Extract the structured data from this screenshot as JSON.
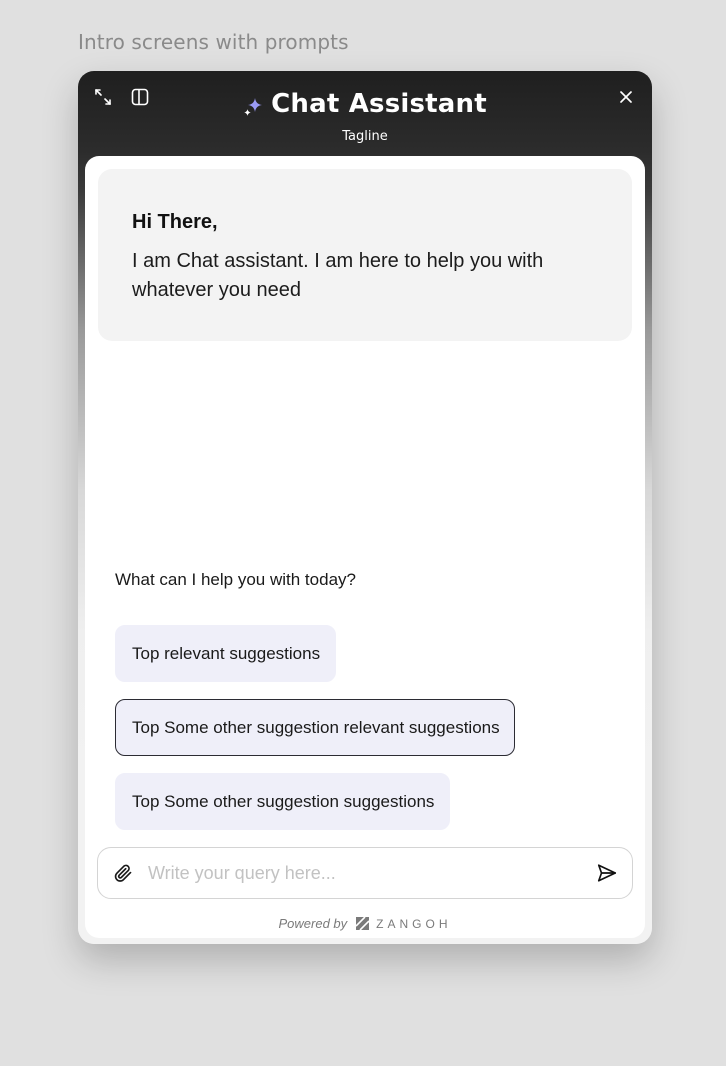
{
  "page": {
    "caption": "Intro screens with prompts"
  },
  "header": {
    "title": "Chat Assistant",
    "tagline": "Tagline",
    "icons": {
      "expand": "expand-icon",
      "split": "split-panel-icon",
      "close": "close-icon",
      "sparkle": "sparkle-icon"
    },
    "accent_color": "#8b8bf0"
  },
  "greeting": {
    "title": "Hi There,",
    "body": "I am Chat assistant. I am here to help you with whatever you need"
  },
  "prompts": {
    "heading": "What can I help you with today?",
    "suggestions": [
      {
        "label": "Top relevant suggestions",
        "selected": false
      },
      {
        "label": "Top Some other suggestion relevant suggestions",
        "selected": true
      },
      {
        "label": "Top Some other suggestion suggestions",
        "selected": false
      }
    ],
    "chip_color": "#efeff9"
  },
  "composer": {
    "placeholder": "Write your query here...",
    "value": "",
    "icons": {
      "attach": "paperclip-icon",
      "send": "send-icon"
    }
  },
  "footer": {
    "powered_by": "Powered by",
    "brand": "ZANGOH"
  }
}
